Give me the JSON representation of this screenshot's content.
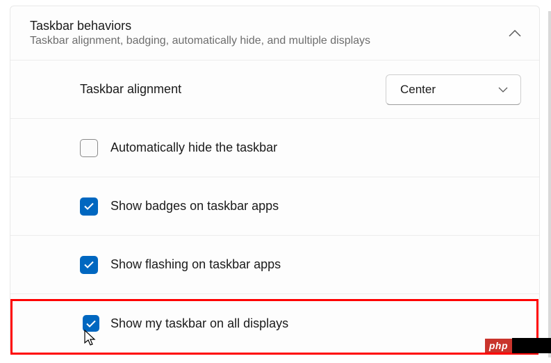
{
  "header": {
    "title": "Taskbar behaviors",
    "subtitle": "Taskbar alignment, badging, automatically hide, and multiple displays"
  },
  "alignment": {
    "label": "Taskbar alignment",
    "selected": "Center"
  },
  "options": {
    "autohide": {
      "label": "Automatically hide the taskbar",
      "checked": false
    },
    "badges": {
      "label": "Show badges on taskbar apps",
      "checked": true
    },
    "flashing": {
      "label": "Show flashing on taskbar apps",
      "checked": true
    },
    "alldisplays": {
      "label": "Show my taskbar on all displays",
      "checked": true
    }
  },
  "watermark": {
    "text": "php"
  }
}
